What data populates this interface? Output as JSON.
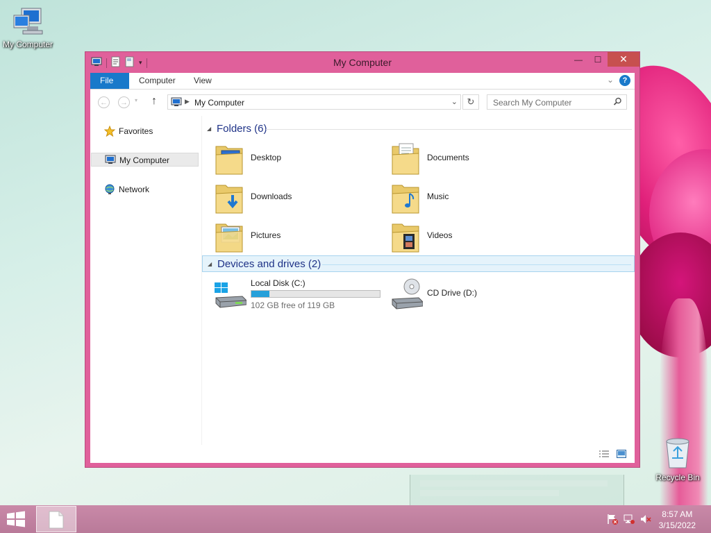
{
  "desktop": {
    "icons": [
      {
        "label": "My Computer",
        "icon": "computer-icon"
      },
      {
        "label": "Recycle Bin",
        "icon": "recycle-bin-icon"
      }
    ]
  },
  "window": {
    "title": "My Computer",
    "controls": {
      "minimize": "minimize-icon",
      "maximize": "maximize-icon",
      "close": "close-icon"
    },
    "ribbon": {
      "tabs": [
        "File",
        "Computer",
        "View"
      ],
      "help": "?"
    },
    "address": {
      "path": "My Computer",
      "search_placeholder": "Search My Computer"
    },
    "nav_pane": {
      "items": [
        {
          "label": "Favorites",
          "icon": "star-icon"
        },
        {
          "label": "My Computer",
          "icon": "computer-icon",
          "selected": true
        },
        {
          "label": "Network",
          "icon": "network-icon"
        }
      ]
    },
    "groups": {
      "folders": {
        "title": "Folders (6)",
        "items": [
          {
            "label": "Desktop",
            "icon": "desktop-folder-icon"
          },
          {
            "label": "Documents",
            "icon": "documents-folder-icon"
          },
          {
            "label": "Downloads",
            "icon": "downloads-folder-icon"
          },
          {
            "label": "Music",
            "icon": "music-folder-icon"
          },
          {
            "label": "Pictures",
            "icon": "pictures-folder-icon"
          },
          {
            "label": "Videos",
            "icon": "videos-folder-icon"
          }
        ]
      },
      "devices": {
        "title": "Devices and drives (2)",
        "items": [
          {
            "label": "Local Disk (C:)",
            "free_text": "102 GB free of 119 GB",
            "used_fraction": 0.143,
            "icon": "hard-drive-icon"
          },
          {
            "label": "CD Drive (D:)",
            "icon": "cd-drive-icon"
          }
        ]
      }
    }
  },
  "taskbar": {
    "time": "8:57 AM",
    "date": "3/15/2022",
    "tray_icons": [
      "action-center-flag-icon",
      "network-tray-icon",
      "volume-muted-icon"
    ]
  },
  "colors": {
    "window_frame": "#e0609b",
    "accent": "#1979ca",
    "progress": "#26a0da",
    "taskbar": "#c085a2"
  }
}
